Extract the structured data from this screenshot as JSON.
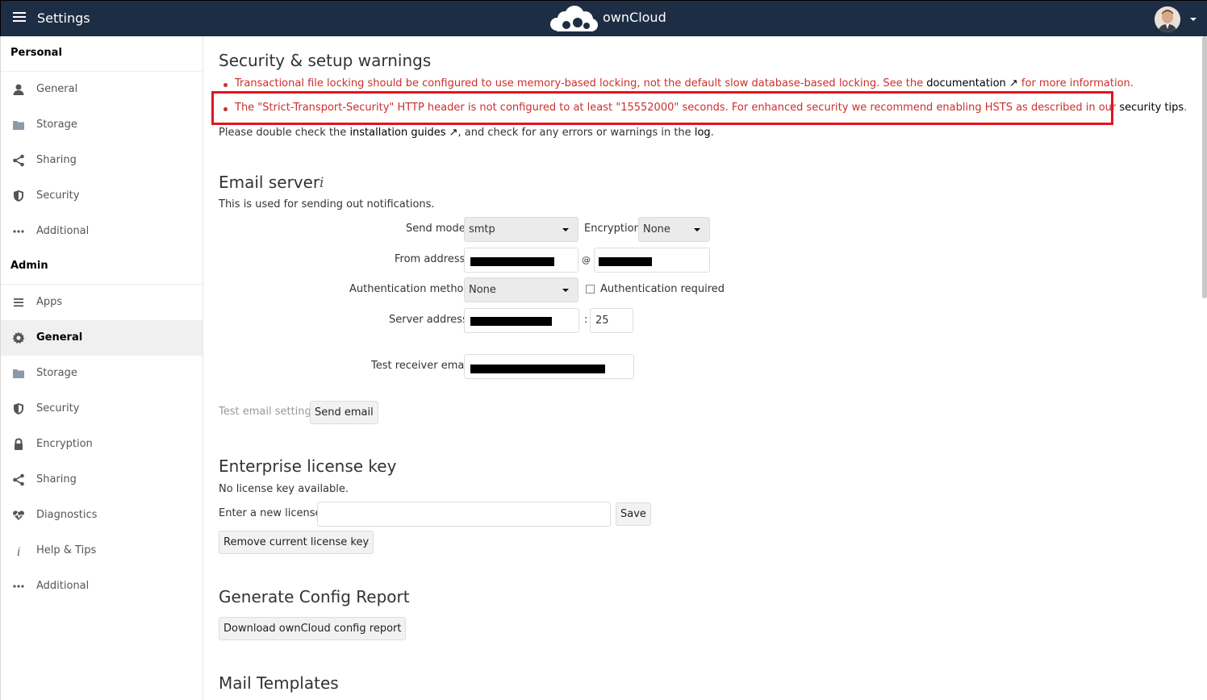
{
  "header": {
    "app_title": "Settings",
    "brand_name": "ownCloud",
    "colors": {
      "header_bg": "#1d2d44",
      "warning_text": "#c9302c",
      "highlight": "#e3141e"
    }
  },
  "sidebar": {
    "personal_heading": "Personal",
    "personal_items": [
      {
        "label": "General",
        "icon": "user-icon"
      },
      {
        "label": "Storage",
        "icon": "folder-icon"
      },
      {
        "label": "Sharing",
        "icon": "share-icon"
      },
      {
        "label": "Security",
        "icon": "shield-icon"
      },
      {
        "label": "Additional",
        "icon": "more-icon"
      }
    ],
    "admin_heading": "Admin",
    "admin_items": [
      {
        "label": "Apps",
        "icon": "list-icon"
      },
      {
        "label": "General",
        "icon": "gear-icon",
        "active": true
      },
      {
        "label": "Storage",
        "icon": "folder-icon"
      },
      {
        "label": "Security",
        "icon": "shield-icon"
      },
      {
        "label": "Encryption",
        "icon": "lock-icon"
      },
      {
        "label": "Sharing",
        "icon": "share-icon"
      },
      {
        "label": "Diagnostics",
        "icon": "heartbeat-icon"
      },
      {
        "label": "Help & Tips",
        "icon": "info-icon"
      },
      {
        "label": "Additional",
        "icon": "more-icon"
      }
    ]
  },
  "security": {
    "title": "Security & setup warnings",
    "warning1_text": "Transactional file locking should be configured to use memory-based locking, not the default slow database-based locking. See the",
    "warning1_link": "documentation ↗",
    "warning1_suffix": "for more information.",
    "warning2_text": "The \"Strict-Transport-Security\" HTTP header is not configured to at least \"15552000\" seconds. For enhanced security we recommend enabling HSTS as described in our",
    "warning2_link": "security tips",
    "warning2_suffix": ".",
    "note_prefix": "Please double check the",
    "note_link1": "installation guides ↗",
    "note_mid": ", and check for any errors or warnings in the",
    "note_link2": "log",
    "note_suffix": "."
  },
  "email": {
    "title": "Email server",
    "info_icon": "info-icon",
    "description": "This is used for sending out notifications.",
    "send_mode_label": "Send mode",
    "send_mode_value": "smtp",
    "encryption_label": "Encryption",
    "encryption_value": "None",
    "from_address_label": "From address",
    "at_sign": "@",
    "auth_method_label": "Authentication method",
    "auth_method_value": "None",
    "auth_required_label": "Authentication required",
    "server_address_label": "Server address",
    "port_separator": ":",
    "port_value": "25",
    "test_receiver_label": "Test receiver email",
    "test_settings_label": "Test email settings",
    "send_email_button": "Send email"
  },
  "license": {
    "title": "Enterprise license key",
    "status": "No license key available.",
    "enter_label": "Enter a new license:",
    "save_button": "Save",
    "remove_button": "Remove current license key"
  },
  "config_report": {
    "title": "Generate Config Report",
    "download_button": "Download ownCloud config report"
  },
  "mail_templates": {
    "title": "Mail Templates"
  }
}
